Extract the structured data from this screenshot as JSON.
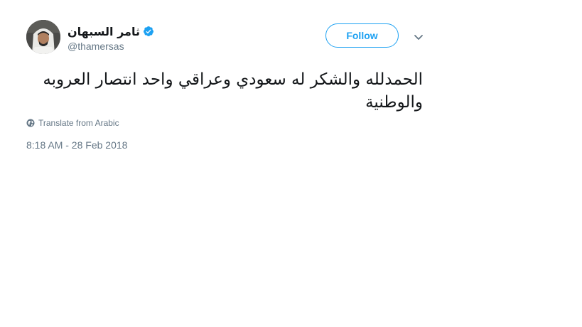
{
  "author": {
    "display_name": "ثامر السبهان",
    "handle": "@thamersas",
    "verified": true,
    "avatar_icon": "profile-photo"
  },
  "actions": {
    "follow_label": "Follow",
    "menu_icon": "chevron-down-icon"
  },
  "tweet": {
    "text": "الحمدلله والشكر له سعودي وعراقي واحد انتصار العروبه والوطنية",
    "translate_label": "Translate from Arabic",
    "translate_icon": "globe-icon",
    "timestamp": "8:18 AM - 28 Feb 2018"
  },
  "colors": {
    "accent": "#1da1f2",
    "text": "#14171a",
    "muted": "#657786"
  }
}
